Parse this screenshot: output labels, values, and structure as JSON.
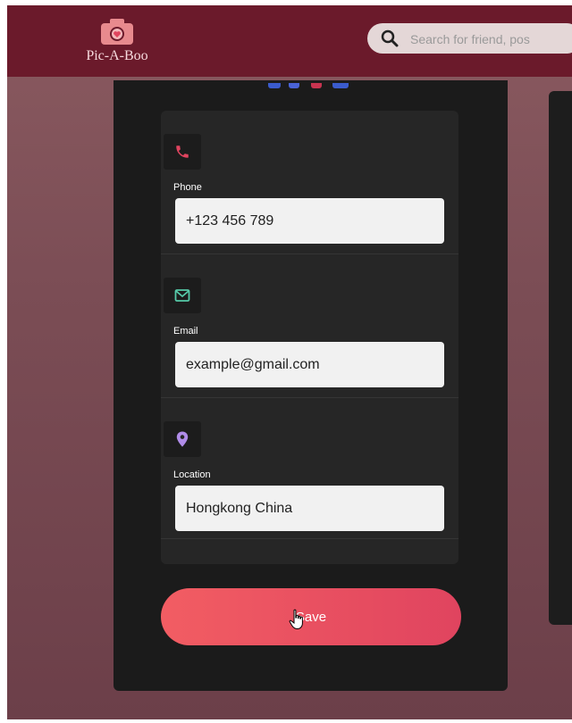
{
  "app": {
    "name": "Pic-A-Boo"
  },
  "search": {
    "placeholder": "Search for friend, pos"
  },
  "contact": {
    "phone": {
      "label": "Phone",
      "value": "+123 456 789"
    },
    "email": {
      "label": "Email",
      "value": "example@gmail.com"
    },
    "location": {
      "label": "Location",
      "value": "Hongkong China"
    }
  },
  "actions": {
    "save_label": "Save"
  },
  "colors": {
    "topbar": "#6b1a2b",
    "logo_accent": "#e88a8e",
    "phone_icon": "#e0445f",
    "email_icon": "#56c9a8",
    "location_icon": "#b08ce8",
    "save_gradient_start": "#f25d63",
    "save_gradient_end": "#e0445f"
  },
  "icons": {
    "logo": "camera-heart-icon",
    "search": "search-icon",
    "phone": "phone-icon",
    "email": "envelope-icon",
    "location": "map-pin-icon",
    "cursor": "hand-pointer-icon"
  }
}
